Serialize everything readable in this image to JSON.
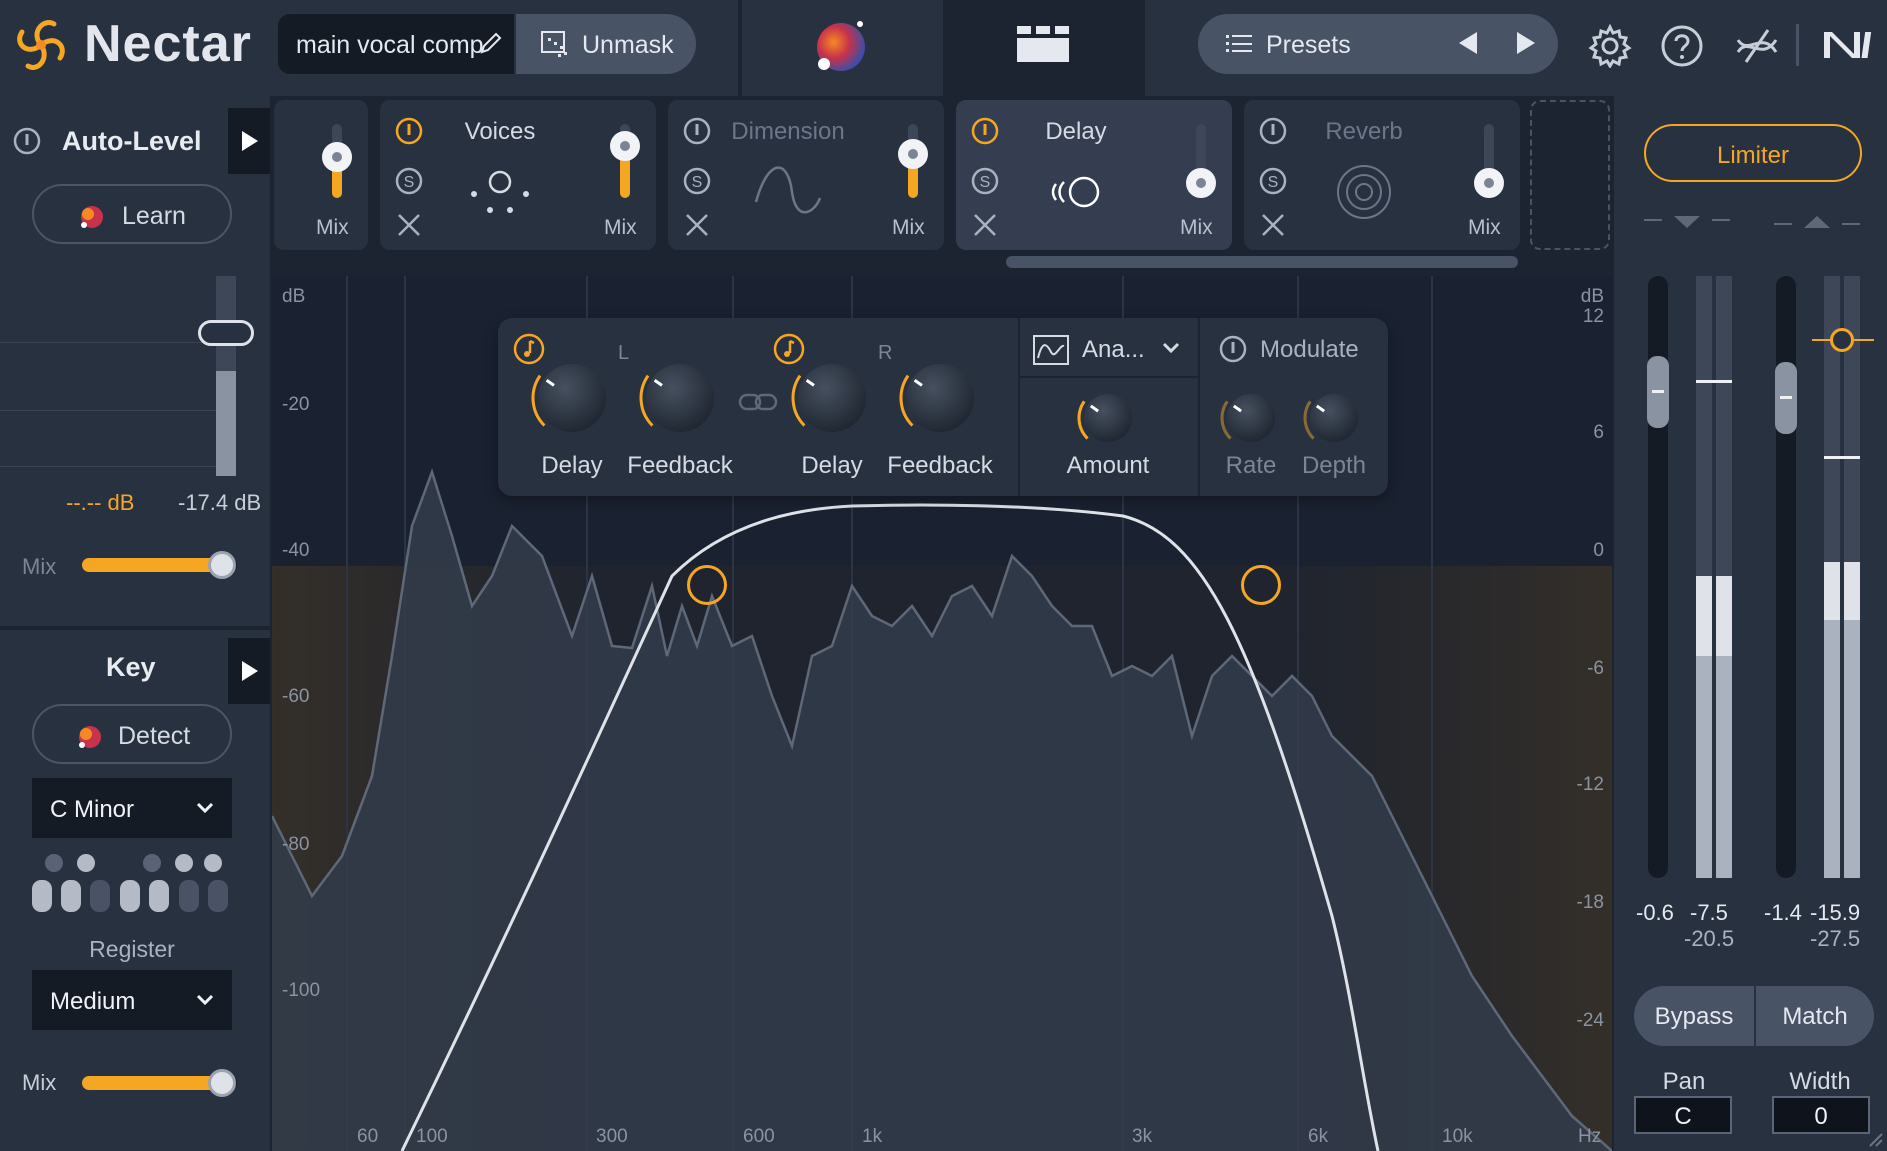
{
  "app": {
    "name": "Nectar"
  },
  "header": {
    "preset_name": "main vocal comp",
    "unmask_label": "Unmask",
    "presets_label": "Presets"
  },
  "auto_level": {
    "title": "Auto-Level",
    "learn_label": "Learn",
    "left_value": "--.-- dB",
    "right_value": "-17.4 dB",
    "mix_label": "Mix",
    "mix_value": 0.9
  },
  "key": {
    "title": "Key",
    "detect_label": "Detect",
    "selected_key": "C Minor",
    "register_label": "Register",
    "register_value": "Medium",
    "mix_label": "Mix",
    "mix_value": 0.9
  },
  "modules": [
    {
      "title": "",
      "mix_label": "Mix",
      "mix_value": 0.55,
      "active": false
    },
    {
      "title": "Voices",
      "mix_label": "Mix",
      "mix_value": 0.7,
      "active": false
    },
    {
      "title": "Dimension",
      "mix_label": "Mix",
      "mix_value": 0.6,
      "active": false
    },
    {
      "title": "Delay",
      "mix_label": "Mix",
      "mix_value": 0.2,
      "active": true
    },
    {
      "title": "Reverb",
      "mix_label": "Mix",
      "mix_value": 0.2,
      "active": false
    }
  ],
  "delay_panel": {
    "left_channel": "L",
    "right_channel": "R",
    "knobs_left": [
      {
        "label": "Delay"
      },
      {
        "label": "Feedback"
      }
    ],
    "knobs_right": [
      {
        "label": "Delay"
      },
      {
        "label": "Feedback"
      }
    ],
    "mode_label": "Ana...",
    "amount_label": "Amount",
    "modulate_label": "Modulate",
    "rate_label": "Rate",
    "depth_label": "Depth"
  },
  "spectrum": {
    "db_left": [
      "dB",
      "-20",
      "-40",
      "-60",
      "-80",
      "-100"
    ],
    "db_right": [
      "dB",
      "12",
      "6",
      "0",
      "-6",
      "-12",
      "-18",
      "-24"
    ],
    "hz_labels": [
      "60",
      "100",
      "300",
      "600",
      "1k",
      "3k",
      "6k",
      "10k",
      "Hz"
    ]
  },
  "limiter": {
    "label": "Limiter",
    "in_peak": "-0.6",
    "in_rms": "-7.5",
    "in_lufs": "-20.5",
    "out_peak": "-1.4",
    "out_rms": "-15.9",
    "out_lufs": "-27.5"
  },
  "footer": {
    "bypass_label": "Bypass",
    "match_label": "Match",
    "pan_label": "Pan",
    "pan_value": "C",
    "width_label": "Width",
    "width_value": "0"
  },
  "colors": {
    "accent": "#f5a623",
    "panel": "#283140",
    "background": "#1d2431"
  }
}
